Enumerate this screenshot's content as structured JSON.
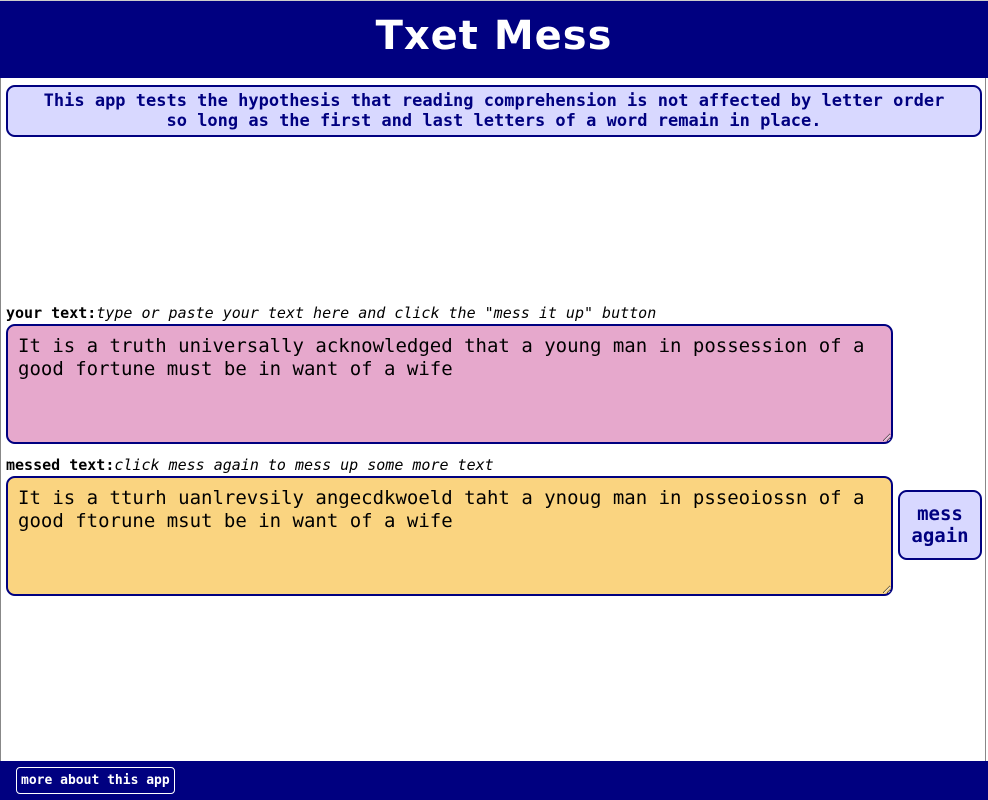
{
  "header": {
    "title": "Txet Mess"
  },
  "intro": {
    "line1": "This app tests the hypothesis that reading comprehension is not affected by letter order",
    "line2": "so long as the first and last letters of a word remain in place."
  },
  "input": {
    "label": "your text:",
    "hint": "type or paste your text here and click the \"mess it up\" button",
    "value": "It is a truth universally acknowledged that a young man in possession of a good fortune must be in want of a wife"
  },
  "output": {
    "label": "messed text:",
    "hint": "click mess again to mess up some more text",
    "value": "It is a tturh uanlrevsily angecdkwoeld taht a ynoug man in psseoiossn of a good ftorune msut be in want of a wife"
  },
  "mess_button": {
    "line1": "mess",
    "line2": "again"
  },
  "footer": {
    "about_label": "more about this app"
  },
  "colors": {
    "navy": "#000080",
    "lavender": "#d8d8ff",
    "pink": "#e6a8cc",
    "amber": "#fad480"
  }
}
